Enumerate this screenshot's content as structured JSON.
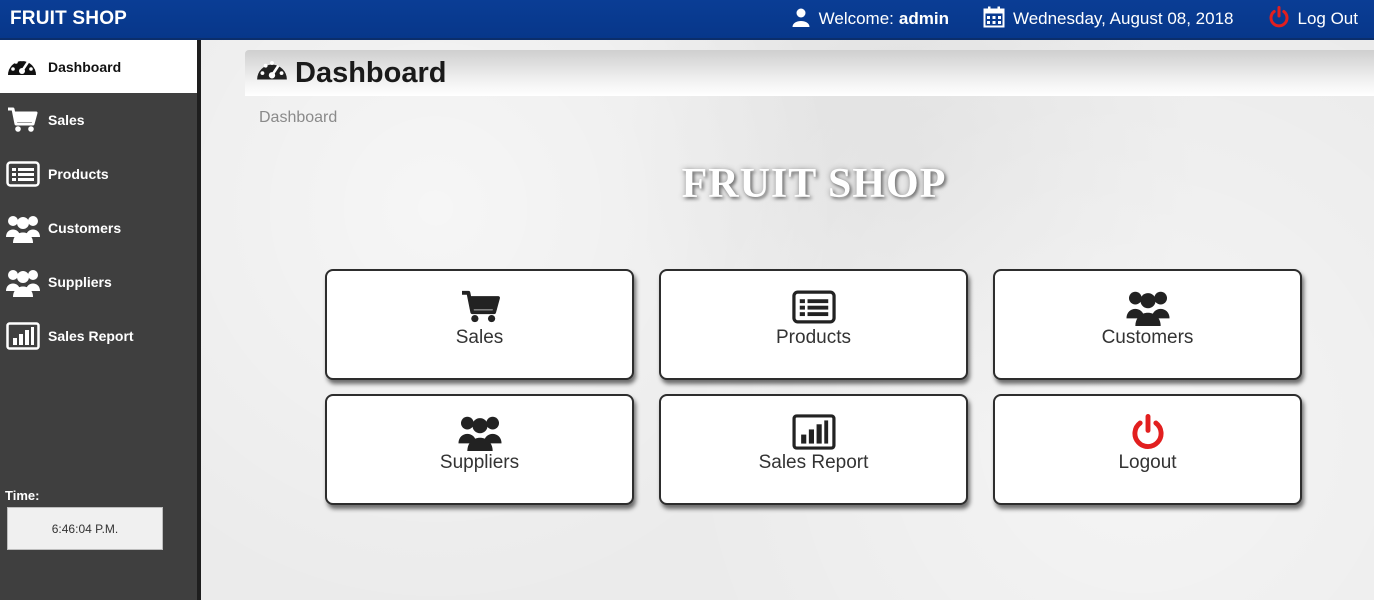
{
  "header": {
    "brand": "FRUIT SHOP",
    "welcome_label": "Welcome:",
    "welcome_user": "admin",
    "date": "Wednesday, August 08, 2018",
    "logout_label": "Log Out",
    "icons": {
      "user": "user-icon",
      "calendar": "calendar-icon",
      "power": "power-icon"
    },
    "logout_icon_color": "#e21f1f",
    "bar_color": "#0a3d95"
  },
  "sidebar": {
    "items": [
      {
        "label": "Dashboard",
        "icon": "dashboard-icon",
        "active": true
      },
      {
        "label": "Sales",
        "icon": "cart-icon"
      },
      {
        "label": "Products",
        "icon": "list-icon"
      },
      {
        "label": "Customers",
        "icon": "users-icon"
      },
      {
        "label": "Suppliers",
        "icon": "users-icon"
      },
      {
        "label": "Sales Report",
        "icon": "bar-chart-icon"
      }
    ],
    "time_label": "Time:",
    "time_value": "6:46:04 P.M."
  },
  "main": {
    "page_title": "Dashboard",
    "breadcrumb": "Dashboard",
    "shop_title": "FRUIT SHOP",
    "tiles": [
      {
        "label": "Sales",
        "icon": "cart-icon"
      },
      {
        "label": "Products",
        "icon": "list-icon"
      },
      {
        "label": "Customers",
        "icon": "users-icon"
      },
      {
        "label": "Suppliers",
        "icon": "users-icon"
      },
      {
        "label": "Sales Report",
        "icon": "bar-chart-icon"
      },
      {
        "label": "Logout",
        "icon": "power-icon",
        "color": "#e21f1f"
      }
    ]
  }
}
